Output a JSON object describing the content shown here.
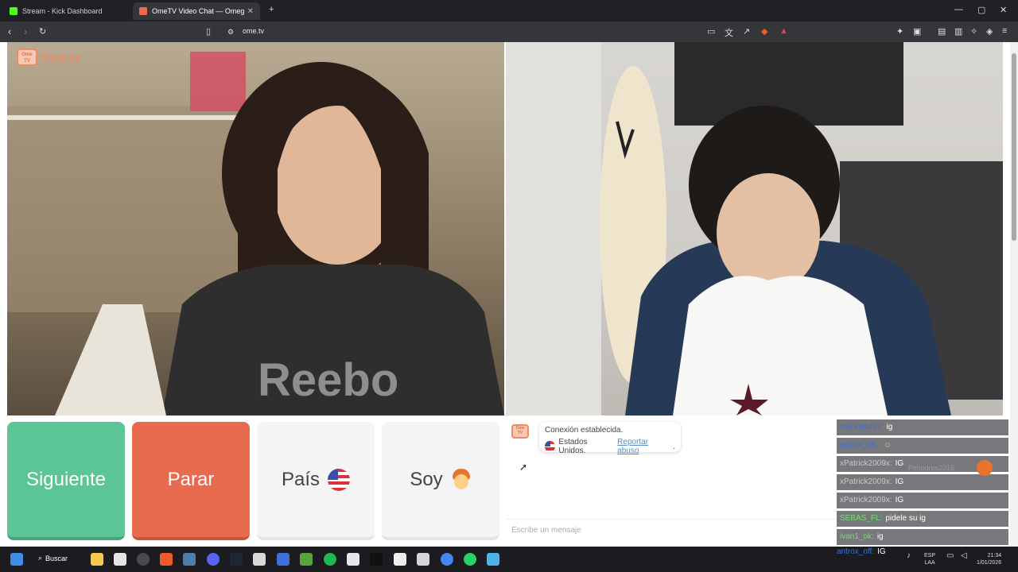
{
  "browser": {
    "tabs": [
      {
        "label": "Stream - Kick Dashboard",
        "color": "#53fc18"
      },
      {
        "label": "OmeTV Video Chat — Omeg",
        "color": "#e86b50"
      }
    ],
    "url": "ome.tv"
  },
  "site": {
    "logo_badge": "Ome TV",
    "logo_text": "Ome.tv"
  },
  "controls": {
    "next_label": "Siguiente",
    "stop_label": "Parar",
    "country_label": "País",
    "soy_label": "Soy"
  },
  "chat": {
    "logo_badge": "Ome TV",
    "status_line": "Conexión establecida.",
    "country_line": "Estados Unidos.",
    "report_link": "Reportar abuso",
    "input_placeholder": "Escribe un mensaje"
  },
  "stream_chat": [
    {
      "user": "crackpod51:",
      "msg": "ig"
    },
    {
      "user": "antrox_off:",
      "msg": ""
    },
    {
      "user": "xPatrick2009x:",
      "msg": "IG"
    },
    {
      "user": "xPatrick2009x:",
      "msg": "IG"
    },
    {
      "user": "xPatrick2009x:",
      "msg": "IG"
    },
    {
      "user": "SEBAS_FL:",
      "msg": "pidele su ig"
    },
    {
      "user": "ivan1_ok:",
      "msg": "ig"
    }
  ],
  "stream_chat_last": {
    "user": "antrox_off:",
    "msg": "IG"
  },
  "ghost_name": "Pimodres2016",
  "taskbar": {
    "search_label": "Buscar",
    "lang_top": "ESP",
    "lang_bottom": "LAA",
    "time": "21:34",
    "date": "1/01/2026"
  }
}
